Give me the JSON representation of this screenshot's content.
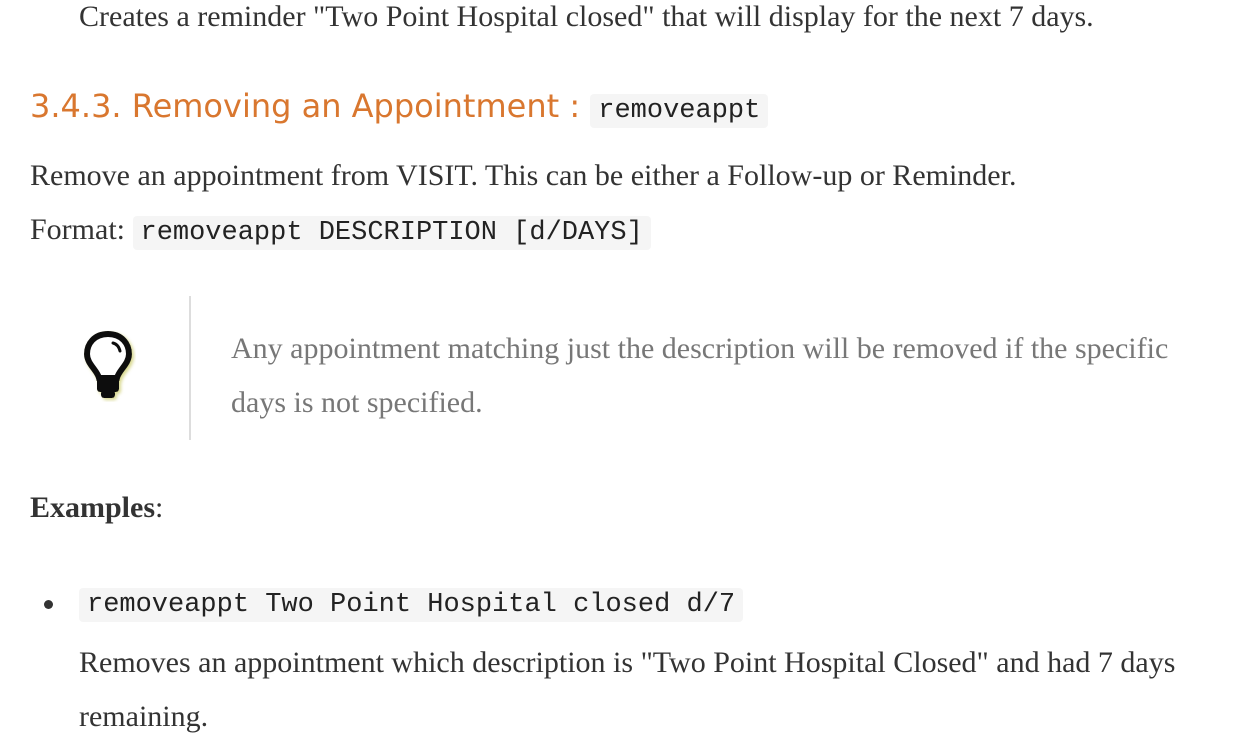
{
  "prev_text": "Creates a reminder \"Two Point Hospital closed\" that will display for the next 7 days.",
  "section": {
    "heading": "3.4.3. Removing an Appointment : ",
    "heading_code": "removeappt",
    "description": "Remove an appointment from VISIT. This can be either a Follow-up or Reminder.",
    "format_label": "Format: ",
    "format_code": "removeappt DESCRIPTION [d/DAYS]",
    "tip": {
      "icon": "lightbulb-icon",
      "text": "Any appointment matching just the description will be removed if the specific days is not specified."
    },
    "examples_label": "Examples",
    "examples_colon": ":",
    "examples": [
      {
        "code": "removeappt Two Point Hospital closed d/7",
        "text": "Removes an appointment which description is \"Two Point Hospital Closed\" and had 7 days remaining."
      }
    ]
  }
}
